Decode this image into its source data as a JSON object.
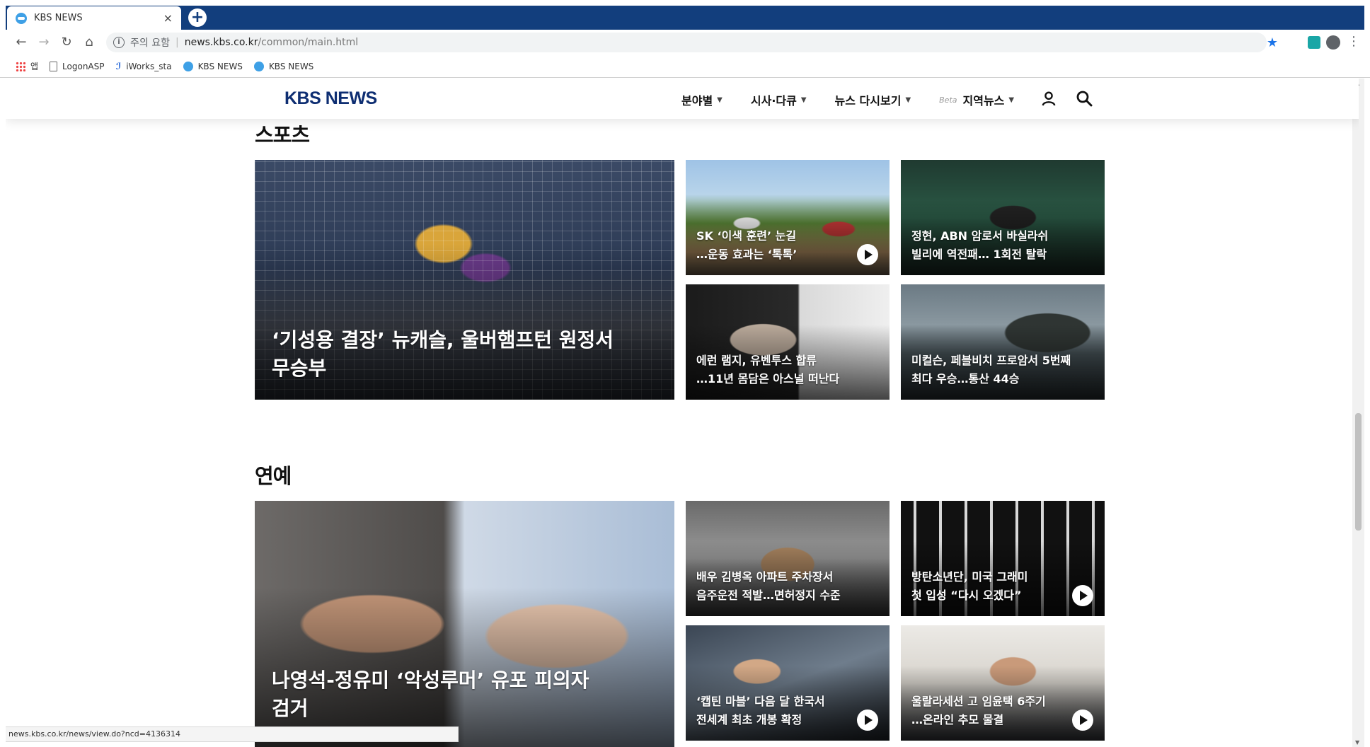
{
  "browser": {
    "tab_title": "KBS NEWS",
    "tab_close": "×",
    "new_tab": "+",
    "security_text": "주의 요함",
    "url_host": "news.kbs.co.kr",
    "url_path": "/common/main.html",
    "bookmarks": [
      "앱",
      "LogonASP",
      "iWorks_sta",
      "KBS NEWS",
      "KBS NEWS"
    ],
    "status_url": "news.kbs.co.kr/news/view.do?ncd=4136314"
  },
  "header": {
    "logo": "KBS NEWS",
    "menu": [
      {
        "label": "분야별",
        "beta": ""
      },
      {
        "label": "시사·다큐",
        "beta": ""
      },
      {
        "label": "뉴스 다시보기",
        "beta": ""
      },
      {
        "label": "지역뉴스",
        "beta": "Beta"
      }
    ]
  },
  "sections": {
    "sports": {
      "title": "스포츠",
      "main": {
        "caption": "‘기성용 결장’ 뉴캐슬, 울버햄프턴 원정서\n무승부"
      },
      "cards": [
        {
          "caption": "SK ‘이색 훈련’ 눈길\n…운동 효과는 ‘톡톡’",
          "video": true
        },
        {
          "caption": "정현, ABN 암로서 바실라쉬\n빌리에 역전패… 1회전 탈락",
          "video": false
        },
        {
          "caption": "에런 램지, 유벤투스 합류\n…11년 몸담은 아스널 떠난다",
          "video": false
        },
        {
          "caption": "미컬슨, 페블비치 프로암서 5번째\n최다 우승…통산 44승",
          "video": false
        }
      ]
    },
    "entertainment": {
      "title": "연예",
      "main": {
        "caption": "나영석-정유미 ‘악성루머’ 유포 피의자\n검거"
      },
      "cards": [
        {
          "caption": "배우 김병옥 아파트 주차장서\n음주운전 적발…면허정지 수준",
          "video": false
        },
        {
          "caption": "방탄소년단, 미국 그래미\n첫 입성 “다시 오겠다”",
          "video": true
        },
        {
          "caption": "‘캡틴 마블’ 다음 달 한국서\n전세계 최초 개봉 확정",
          "video": true
        },
        {
          "caption": "울랄라세션 고 임윤택 6주기\n…온라인 추모 물결",
          "video": true
        }
      ]
    }
  }
}
